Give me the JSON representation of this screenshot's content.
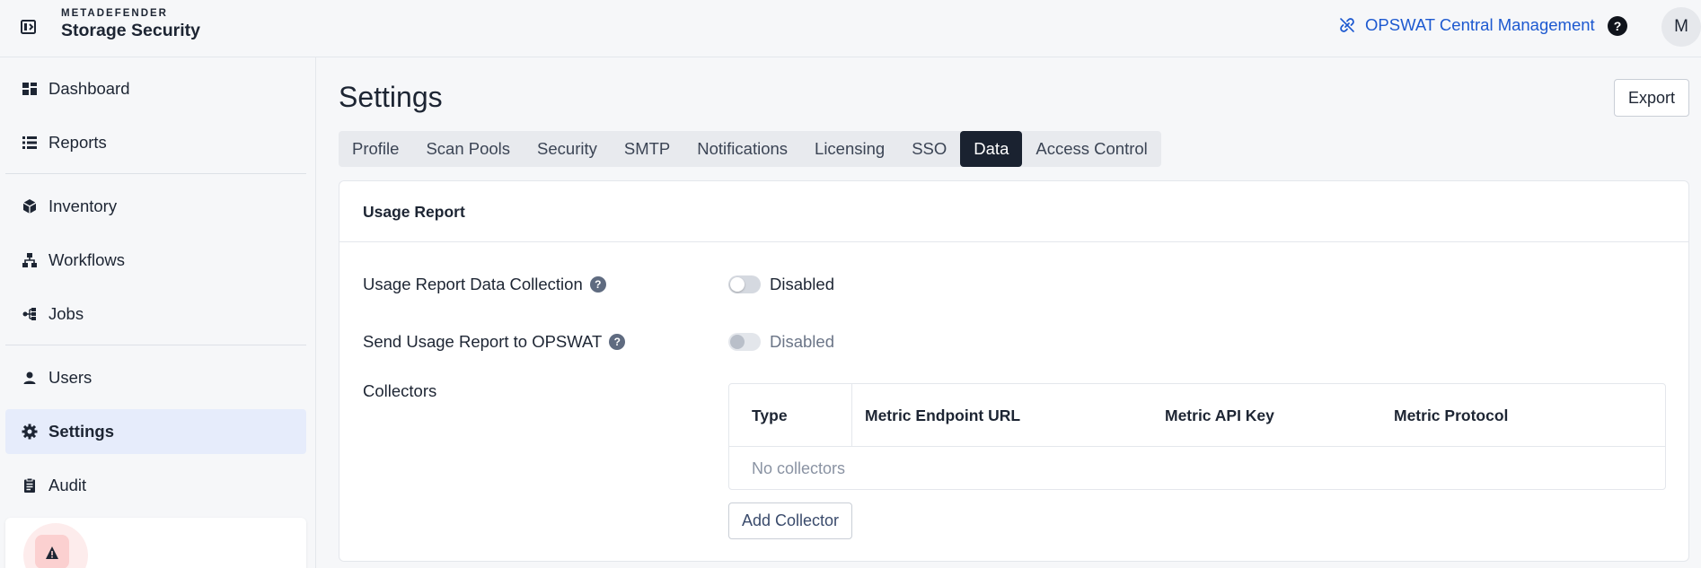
{
  "header": {
    "brand_top": "METADEFENDER",
    "brand_main": "Storage Security",
    "central_link": "OPSWAT Central Management",
    "help": "?",
    "avatar_initial": "M",
    "accent_color": "#1d59d0"
  },
  "sidebar": {
    "items": [
      {
        "label": "Dashboard",
        "icon": "dashboard-icon"
      },
      {
        "label": "Reports",
        "icon": "list-icon"
      },
      {
        "label": "Inventory",
        "icon": "cube-icon"
      },
      {
        "label": "Workflows",
        "icon": "workflow-icon"
      },
      {
        "label": "Jobs",
        "icon": "jobs-icon"
      },
      {
        "label": "Users",
        "icon": "user-icon"
      },
      {
        "label": "Settings",
        "icon": "gear-icon",
        "active": true
      },
      {
        "label": "Audit",
        "icon": "clipboard-icon"
      }
    ],
    "active_bg": "#e6ecfb"
  },
  "main": {
    "title": "Settings",
    "export_label": "Export",
    "tabs": [
      {
        "label": "Profile"
      },
      {
        "label": "Scan Pools"
      },
      {
        "label": "Security"
      },
      {
        "label": "SMTP"
      },
      {
        "label": "Notifications"
      },
      {
        "label": "Licensing"
      },
      {
        "label": "SSO"
      },
      {
        "label": "Data",
        "active": true
      },
      {
        "label": "Access Control"
      }
    ],
    "card": {
      "title": "Usage Report",
      "rows": [
        {
          "label": "Usage Report Data Collection",
          "status": "Disabled",
          "enabled": false
        },
        {
          "label": "Send Usage Report to OPSWAT",
          "status": "Disabled",
          "enabled": false,
          "interactive": false
        }
      ],
      "collectors_label": "Collectors",
      "table": {
        "columns": [
          "Type",
          "Metric Endpoint URL",
          "Metric API Key",
          "Metric Protocol"
        ],
        "empty_text": "No collectors"
      },
      "add_button": "Add Collector"
    }
  }
}
